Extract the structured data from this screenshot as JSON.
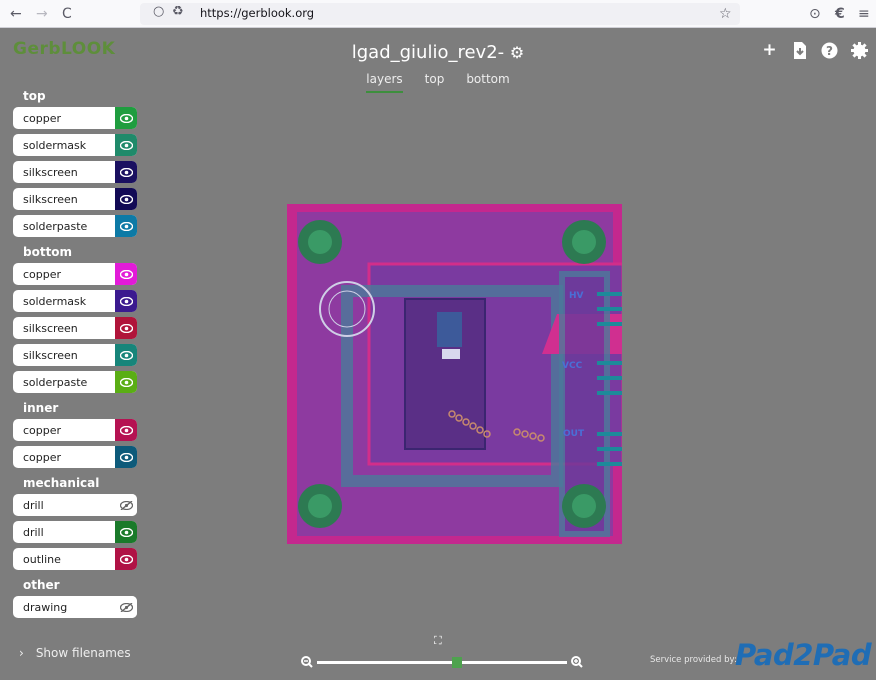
{
  "browser": {
    "back_icon": "←",
    "forward_icon": "→",
    "reload_icon": "C",
    "url": "https://gerblook.org",
    "star_icon": "☆",
    "pocket_icon": "⊙",
    "menu_icon": "≡"
  },
  "app": {
    "logo": "GerbLOOK",
    "board_title": "lgad_giulio_rev2-",
    "tabs": [
      {
        "label": "layers",
        "active": true
      },
      {
        "label": "top",
        "active": false
      },
      {
        "label": "bottom",
        "active": false
      }
    ],
    "top_icons": [
      "plus-icon",
      "download-icon",
      "help-icon",
      "settings-icon"
    ]
  },
  "sidebar": {
    "groups": [
      {
        "title": "top",
        "layers": [
          {
            "name": "copper",
            "color": "#1f9d3f",
            "visible": true
          },
          {
            "name": "soldermask",
            "color": "#1f8a6a",
            "visible": true
          },
          {
            "name": "silkscreen",
            "color": "#1a1060",
            "visible": true
          },
          {
            "name": "silkscreen",
            "color": "#120a55",
            "visible": true
          },
          {
            "name": "solderpaste",
            "color": "#0d7aa6",
            "visible": true
          }
        ]
      },
      {
        "title": "bottom",
        "layers": [
          {
            "name": "copper",
            "color": "#e21bd8",
            "visible": true
          },
          {
            "name": "soldermask",
            "color": "#3b1a8f",
            "visible": true
          },
          {
            "name": "silkscreen",
            "color": "#b0143a",
            "visible": true
          },
          {
            "name": "silkscreen",
            "color": "#17857a",
            "visible": true
          },
          {
            "name": "solderpaste",
            "color": "#5aae14",
            "visible": true
          }
        ]
      },
      {
        "title": "inner",
        "layers": [
          {
            "name": "copper",
            "color": "#b51252",
            "visible": true
          },
          {
            "name": "copper",
            "color": "#0d5a7a",
            "visible": true
          }
        ]
      },
      {
        "title": "mechanical",
        "layers": [
          {
            "name": "drill",
            "color": "#ffffff",
            "visible": false
          },
          {
            "name": "drill",
            "color": "#1a7a2a",
            "visible": true
          },
          {
            "name": "outline",
            "color": "#b01245",
            "visible": true
          }
        ]
      },
      {
        "title": "other",
        "layers": [
          {
            "name": "drawing",
            "color": "#ffffff",
            "visible": false
          }
        ]
      }
    ]
  },
  "footer": {
    "show_filenames": "Show filenames",
    "service_text": "Service provided by:",
    "service_logo": "Pad2Pad",
    "zoom_level": 0.56
  },
  "board": {
    "labels": [
      "HV",
      "VCC",
      "OUT"
    ]
  }
}
